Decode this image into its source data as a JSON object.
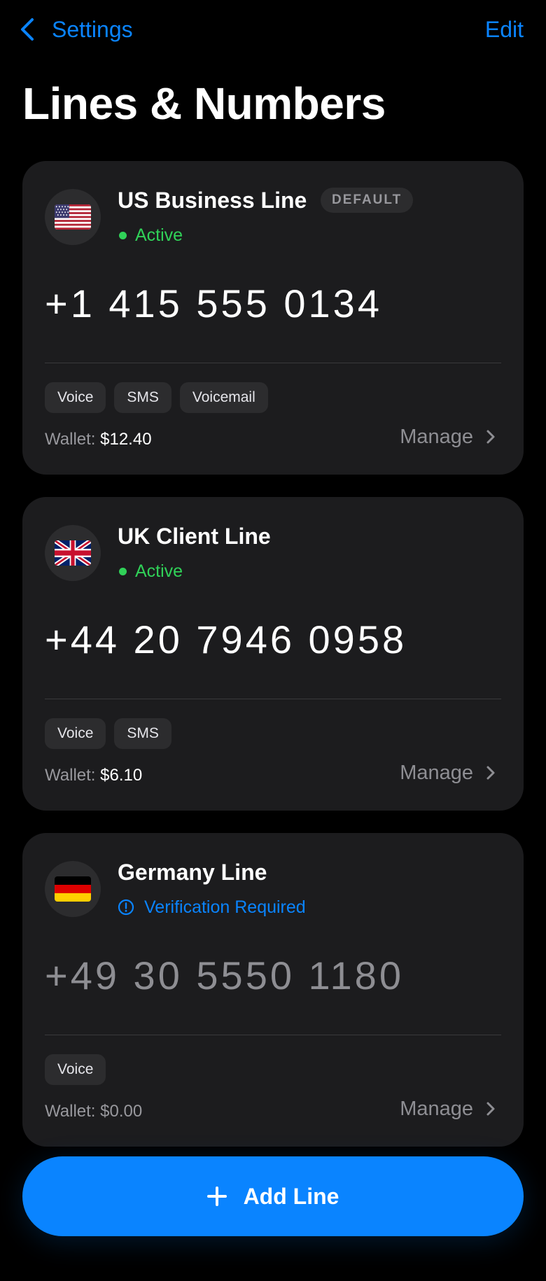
{
  "nav": {
    "back_label": "Settings",
    "edit_label": "Edit"
  },
  "page": {
    "title": "Lines & Numbers"
  },
  "lines": [
    {
      "name": "US Business Line",
      "badge": "DEFAULT",
      "flag": "us-flag",
      "status": "Active",
      "number": "+1 415 555 0134",
      "features": [
        "Voice",
        "SMS",
        "Voicemail"
      ],
      "wallet_label": "Wallet:",
      "wallet_amount": "$12.40",
      "manage_label": "Manage"
    },
    {
      "name": "UK Client Line",
      "flag": "uk-flag",
      "status": "Active",
      "number": "+44 20 7946 0958",
      "features": [
        "Voice",
        "SMS"
      ],
      "wallet_label": "Wallet:",
      "wallet_amount": "$6.10",
      "manage_label": "Manage"
    },
    {
      "name": "Germany Line",
      "flag": "germany-flag",
      "status": "Verification Required",
      "number": "+49 30 5550 1180",
      "features": [
        "Voice"
      ],
      "wallet_label": "Wallet:",
      "wallet_amount": "$0.00",
      "manage_label": "Manage"
    }
  ],
  "add_button": {
    "label": "Add Line"
  },
  "colors": {
    "accent": "#0a84ff",
    "active": "#30d158",
    "card": "#1c1c1e",
    "background": "#000000"
  }
}
